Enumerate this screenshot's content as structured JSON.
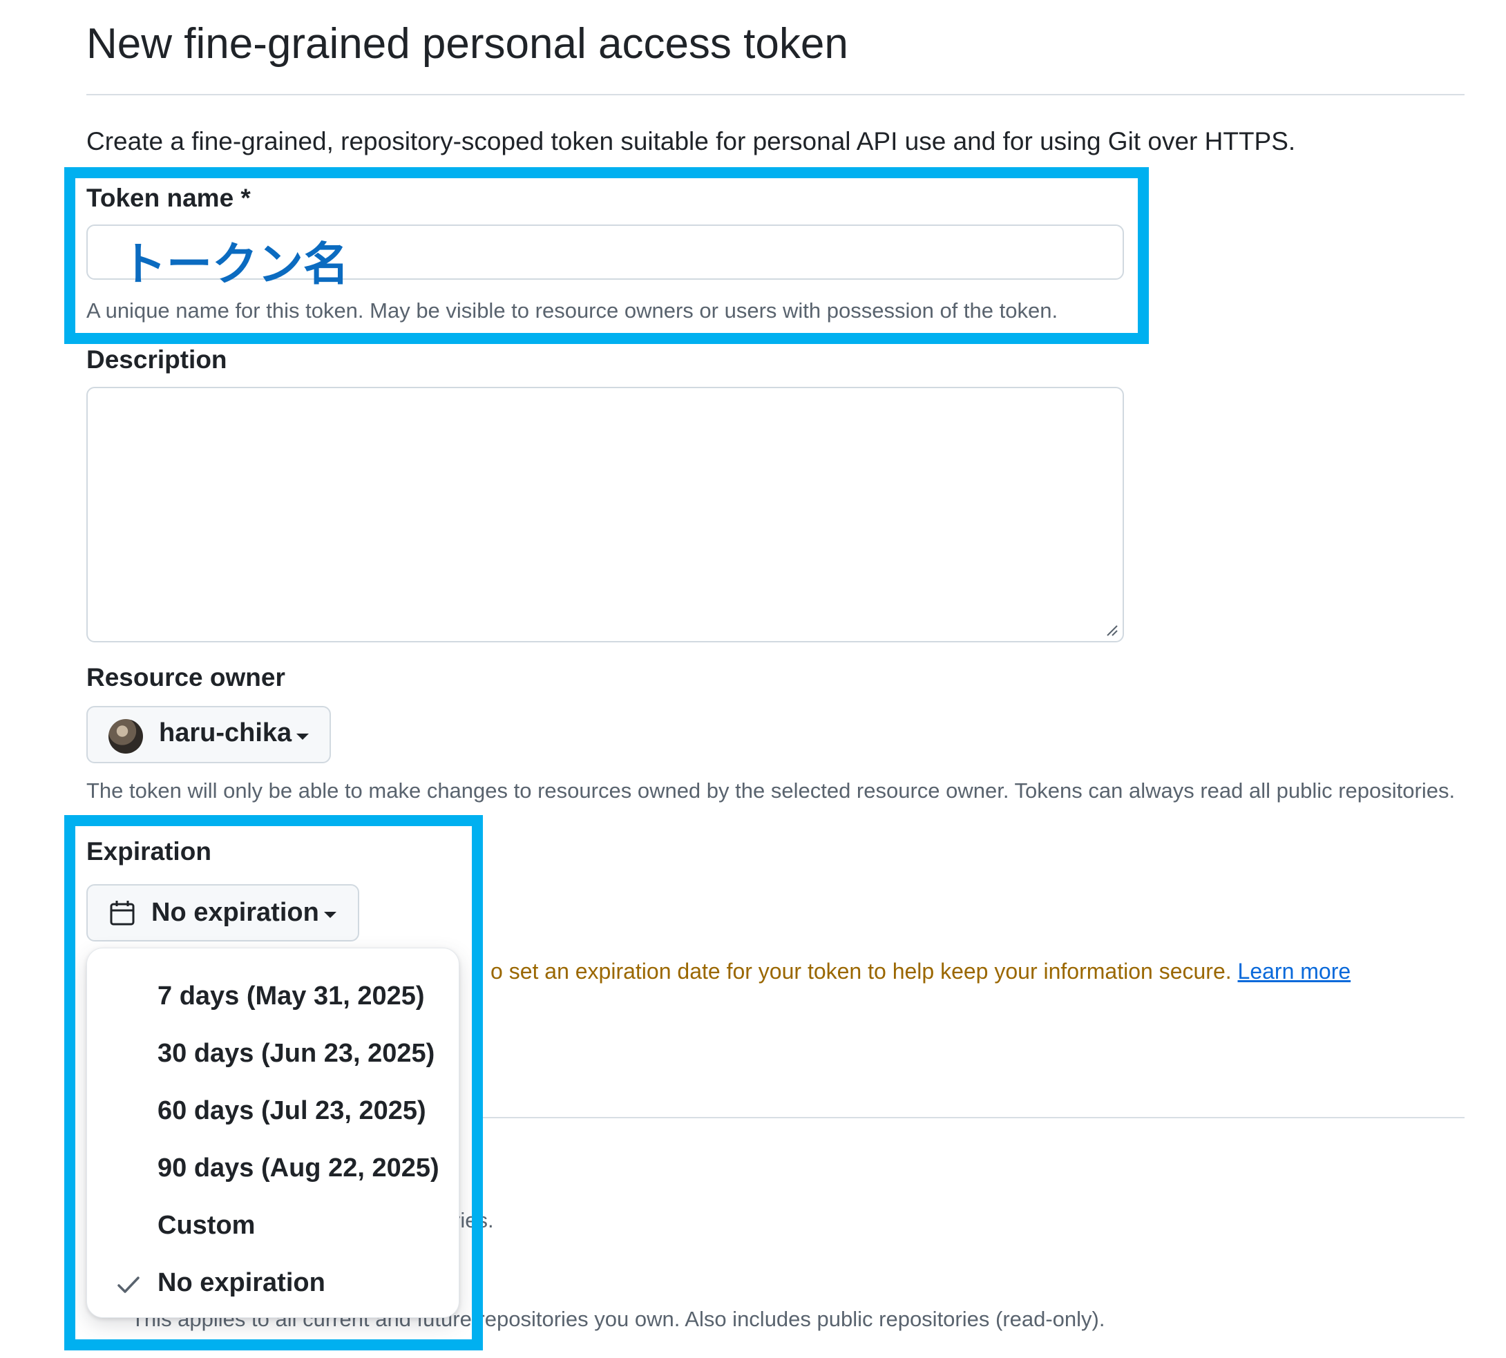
{
  "header": {
    "title": "New fine-grained personal access token",
    "intro": "Create a fine-grained, repository-scoped token suitable for personal API use and for using Git over HTTPS."
  },
  "token_name": {
    "label": "Token name *",
    "value": "トークン名",
    "hint": "A unique name for this token. May be visible to resource owners or users with possession of the token."
  },
  "description": {
    "label": "Description",
    "value": ""
  },
  "resource_owner": {
    "label": "Resource owner",
    "selected": "haru-chika",
    "hint": "The token will only be able to make changes to resources owned by the selected resource owner. Tokens can always read all public repositories."
  },
  "expiration": {
    "label": "Expiration",
    "selected": "No expiration",
    "warning_fragment": "o set an expiration date for your token to help keep your information secure.",
    "learn_more": "Learn more",
    "options": [
      {
        "label": "7 days (May 31, 2025)",
        "checked": false
      },
      {
        "label": "30 days (Jun 23, 2025)",
        "checked": false
      },
      {
        "label": "60 days (Jul 23, 2025)",
        "checked": false
      },
      {
        "label": "90 days (Aug 22, 2025)",
        "checked": false
      },
      {
        "label": "Custom",
        "checked": false
      },
      {
        "label": "No expiration",
        "checked": true
      }
    ]
  },
  "repository_access": {
    "partial_fragment": "ries.",
    "applies_text": "This applies to all current and future repositories you own. Also includes public repositories (read-only)."
  },
  "colors": {
    "highlight": "#00b0f0",
    "link": "#0969da",
    "warning": "#9a6700",
    "token_value": "#0b6bc0"
  }
}
